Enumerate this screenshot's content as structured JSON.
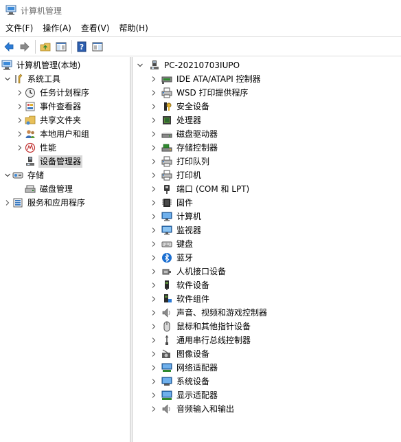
{
  "window": {
    "title": "计算机管理"
  },
  "menu": [
    {
      "label": "文件(F)"
    },
    {
      "label": "操作(A)"
    },
    {
      "label": "查看(V)"
    },
    {
      "label": "帮助(H)"
    }
  ],
  "left_tree": {
    "root": "计算机管理(本地)",
    "system_tools": "系统工具",
    "task_scheduler": "任务计划程序",
    "event_viewer": "事件查看器",
    "shared_folders": "共享文件夹",
    "local_users": "本地用户和组",
    "performance": "性能",
    "device_manager": "设备管理器",
    "storage": "存储",
    "disk_management": "磁盘管理",
    "services": "服务和应用程序"
  },
  "right_tree": {
    "root": "PC-20210703IUPO",
    "items": [
      {
        "label": "IDE ATA/ATAPI 控制器",
        "icon": "ide-controller-icon"
      },
      {
        "label": "WSD 打印提供程序",
        "icon": "printer-icon"
      },
      {
        "label": "安全设备",
        "icon": "security-device-icon"
      },
      {
        "label": "处理器",
        "icon": "processor-icon"
      },
      {
        "label": "磁盘驱动器",
        "icon": "disk-drive-icon"
      },
      {
        "label": "存储控制器",
        "icon": "storage-controller-icon"
      },
      {
        "label": "打印队列",
        "icon": "printer-icon"
      },
      {
        "label": "打印机",
        "icon": "printer-icon"
      },
      {
        "label": "端口 (COM 和 LPT)",
        "icon": "port-icon"
      },
      {
        "label": "固件",
        "icon": "firmware-icon"
      },
      {
        "label": "计算机",
        "icon": "computer-icon"
      },
      {
        "label": "监视器",
        "icon": "monitor-icon"
      },
      {
        "label": "键盘",
        "icon": "keyboard-icon"
      },
      {
        "label": "蓝牙",
        "icon": "bluetooth-icon"
      },
      {
        "label": "人机接口设备",
        "icon": "hid-icon"
      },
      {
        "label": "软件设备",
        "icon": "software-device-icon"
      },
      {
        "label": "软件组件",
        "icon": "software-component-icon"
      },
      {
        "label": "声音、视频和游戏控制器",
        "icon": "speaker-icon"
      },
      {
        "label": "鼠标和其他指针设备",
        "icon": "mouse-icon"
      },
      {
        "label": "通用串行总线控制器",
        "icon": "usb-icon"
      },
      {
        "label": "图像设备",
        "icon": "camera-icon"
      },
      {
        "label": "网络适配器",
        "icon": "network-adapter-icon"
      },
      {
        "label": "系统设备",
        "icon": "system-device-icon"
      },
      {
        "label": "显示适配器",
        "icon": "display-adapter-icon"
      },
      {
        "label": "音频输入和输出",
        "icon": "audio-io-icon"
      }
    ]
  },
  "colors": {
    "selection": "#d9d9d9",
    "accent": "#2c7bd6",
    "title_text": "#6d6d6d"
  }
}
